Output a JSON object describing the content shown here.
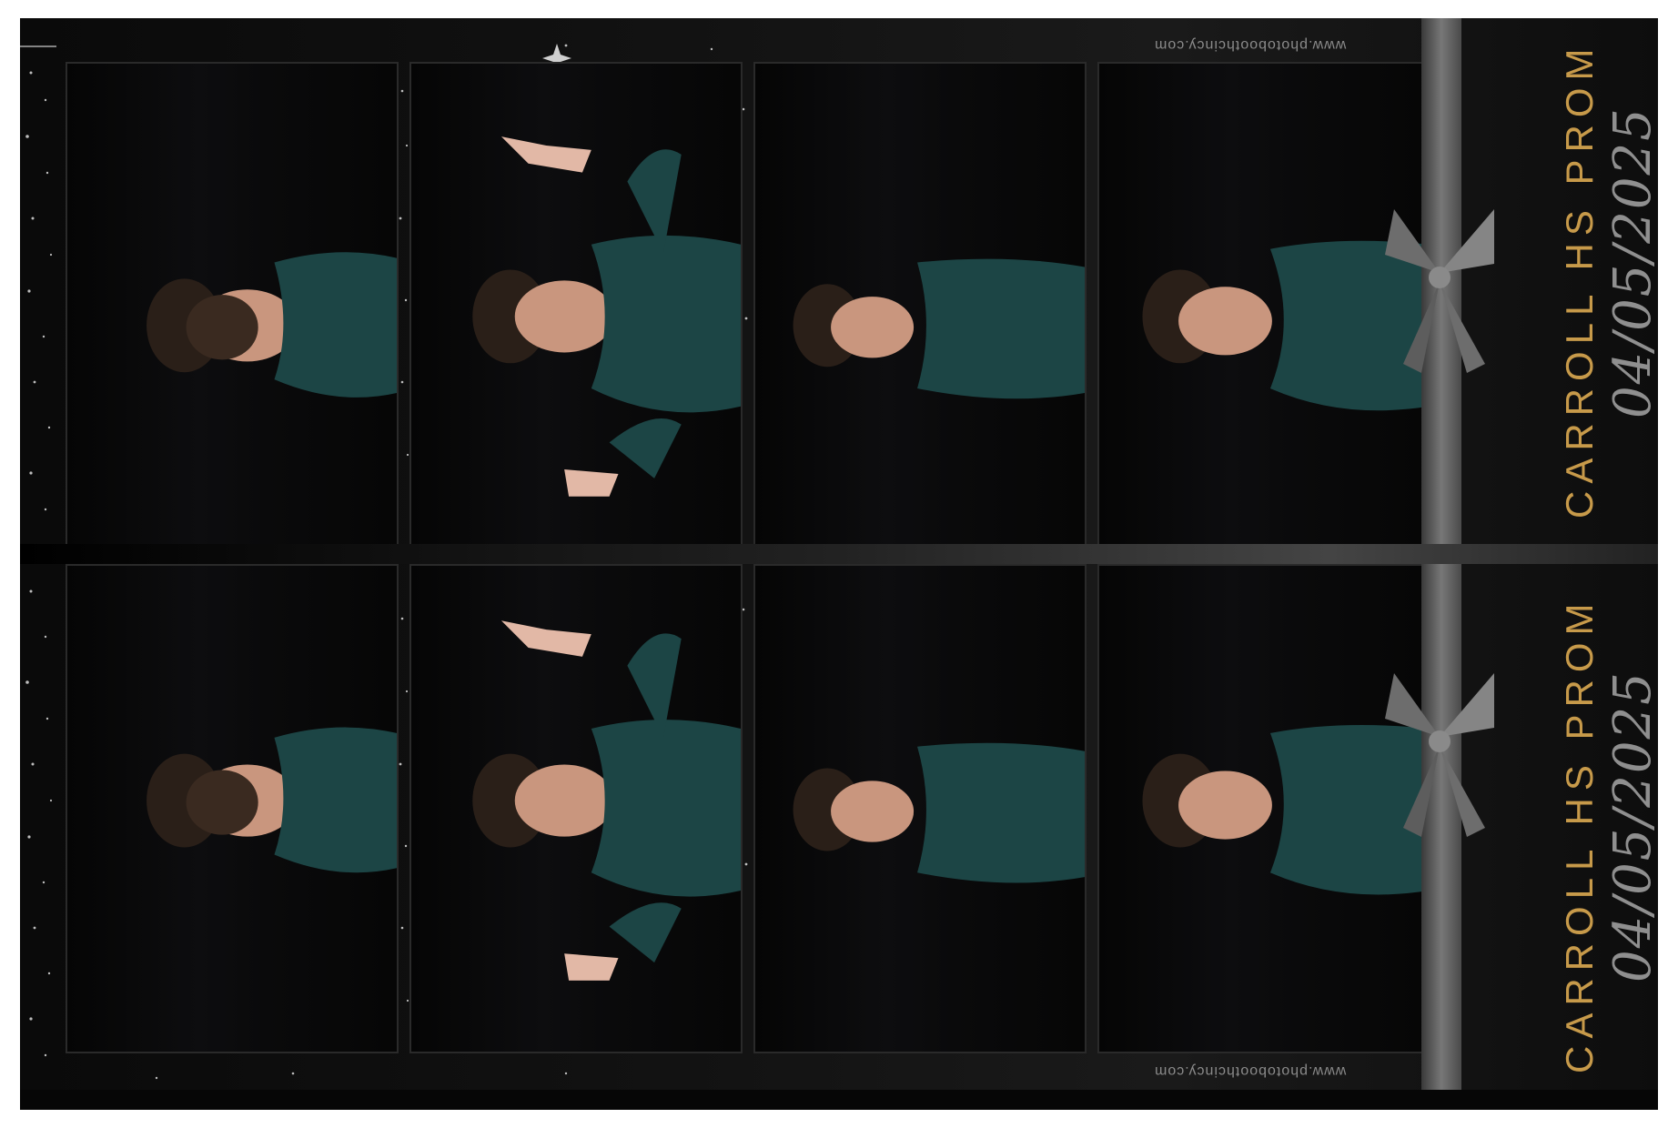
{
  "event": {
    "title": "CARROLL HS PROM",
    "date": "04/05/2025",
    "website": "www.photoboothcincy.com"
  },
  "strips": [
    {
      "position": "top",
      "photos": [
        "smile",
        "wave",
        "smile-small",
        "smile-shoulders"
      ]
    },
    {
      "position": "bottom",
      "photos": [
        "smile",
        "wave",
        "smile-small",
        "smile-shoulders"
      ]
    }
  ],
  "colors": {
    "background": "#060606",
    "title": "#c79a4a",
    "date": "#8f8f8f",
    "ribbon": "#777777",
    "sweater": "#1c4545"
  }
}
